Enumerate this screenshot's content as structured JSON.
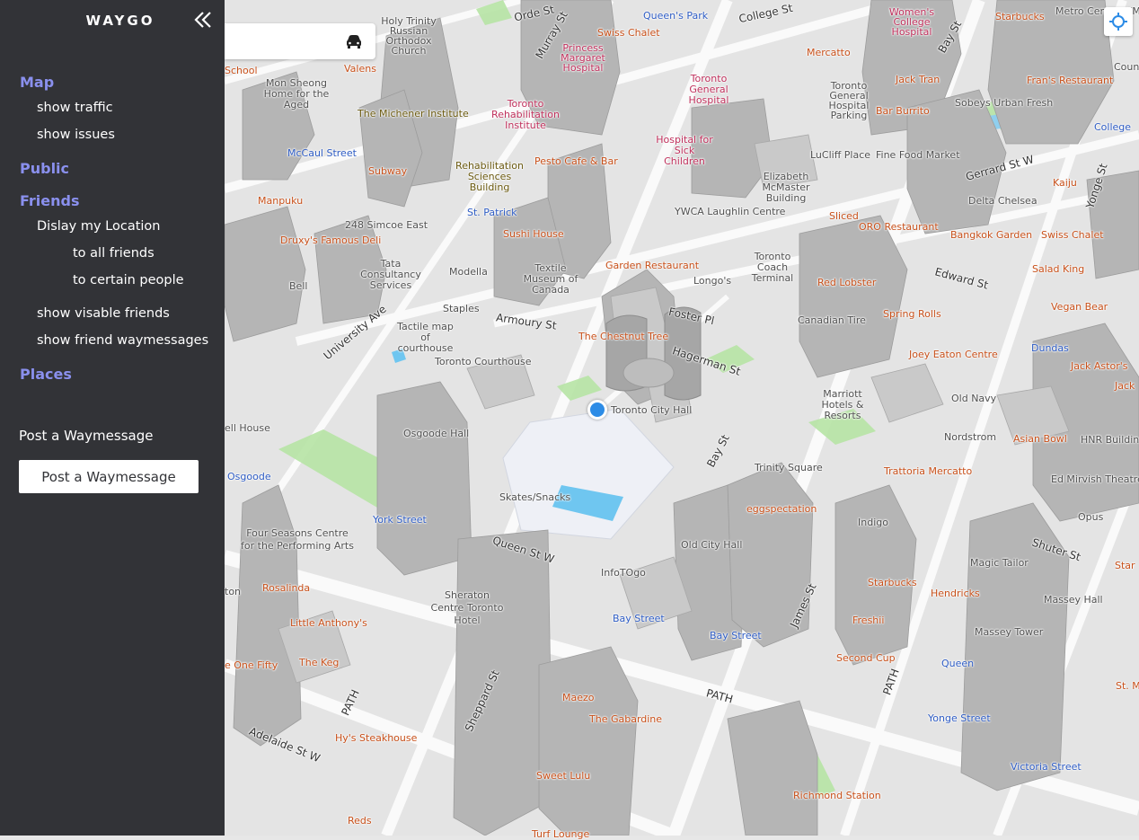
{
  "sidebar": {
    "brand": "WAYGO",
    "collapse_icon": "chevron-double-left-icon",
    "sections": {
      "map": {
        "label": "Map",
        "items": [
          "show traffic",
          "show issues"
        ]
      },
      "public": {
        "label": "Public"
      },
      "friends": {
        "label": "Friends",
        "display_location": "Dislay my Location",
        "to_all": "to all friends",
        "to_certain": "to certain people",
        "visible_friends": "show visable friends",
        "waymessages": "show friend waymessages"
      },
      "places": {
        "label": "Places"
      }
    },
    "post_label": "Post a Waymessage",
    "post_button": "Post a Waymessage",
    "colors": {
      "background": "#323337",
      "accent": "#8a90ee"
    }
  },
  "map": {
    "search_icon": "car-icon",
    "locate_icon": "crosshair-icon",
    "streets": [
      "Orde St",
      "College St",
      "Murray St",
      "Gerrard St W",
      "Bay St",
      "Yonge St",
      "University Ave",
      "Armoury St",
      "Foster Pl",
      "Hagerman St",
      "Edward St",
      "Queen St W",
      "Bay St",
      "James St",
      "Shuter St",
      "Sheppard St",
      "Adelaide St W",
      "PATH",
      "PATH",
      "PATH"
    ],
    "labels": {
      "holy_trinity": "Holy Trinity Russian Orthodox Church",
      "queens_park": "Queen's Park",
      "womens_college": "Women's College Hospital",
      "starbucks_top": "Starbucks",
      "metro_central": "Metro Central YMCA",
      "swiss_chalet_top": "Swiss Chalet",
      "princess_margaret": "Princess Margaret Hospital",
      "mercatto": "Mercatto",
      "valens": "Valens",
      "school": "School",
      "mon_sheong": "Mon Sheong Home for the Aged",
      "michener": "The Michener Institute",
      "toronto_rehab": "Toronto Rehabilitation Institute",
      "toronto_general": "Toronto General Hospital",
      "tgh_parking": "Toronto General Hospital Parking",
      "jack_tran": "Jack Tran",
      "bar_burrito": "Bar Burrito",
      "sobeys": "Sobeys Urban Fresh",
      "frans": "Fran's Restaurant",
      "county": "County",
      "college": "College",
      "mccaul": "McCaul Street",
      "subway": "Subway",
      "rehab_sciences": "Rehabilitation Sciences Building",
      "pesto": "Pesto Cafe & Bar",
      "sick_kids": "Hospital for Sick Children",
      "luclif": "LuCliff Place",
      "fine_food": "Fine Food Market",
      "kaiju": "Kaiju",
      "manpuku": "Manpuku",
      "simcoe": "248 Simcoe East",
      "st_patrick": "St. Patrick",
      "mcmaster": "Elizabeth McMaster Building",
      "delta": "Delta Chelsea",
      "ywca": "YWCA Laughlin Centre",
      "sliced": "Sliced",
      "oro": "ORO Restaurant",
      "bangkok": "Bangkok Garden",
      "swiss_chalet": "Swiss Chalet",
      "druxys": "Druxy's Famous Deli",
      "sushi_house": "Sushi House",
      "tata": "Tata Consultancy Services",
      "modella": "Modella",
      "textile": "Textile Museum of Canada",
      "garden_rest": "Garden Restaurant",
      "coach": "Toronto Coach Terminal",
      "salad_king": "Salad King",
      "bell": "Bell",
      "longos": "Longo's",
      "red_lobster": "Red Lobster",
      "vegan_bear": "Vegan Bear",
      "staples": "Staples",
      "spring_rolls": "Spring Rolls",
      "canadian_tire": "Canadian Tire",
      "tactile": "Tactile map of courthouse",
      "dundas": "Dundas",
      "chestnut": "The Chestnut Tree",
      "joey": "Joey Eaton Centre",
      "jack_astors": "Jack Astor's",
      "courthouse": "Toronto Courthouse",
      "jack": "Jack",
      "marriott": "Marriott Hotels & Resorts",
      "old_navy": "Old Navy",
      "city_hall": "Toronto City Hall",
      "bell_house": "ell House",
      "osgoode_hall": "Osgoode Hall",
      "nordstrom": "Nordstrom",
      "asian_bowl": "Asian Bowl",
      "hnr": "HNR Building",
      "osgoode": "Osgoode",
      "trinity": "Trinity Square",
      "trattoria": "Trattoria Mercatto",
      "mirvish": "Ed Mirvish Theatre",
      "skates": "Skates/Snacks",
      "eggspectation": "eggspectation",
      "york": "York Street",
      "indigo": "Indigo",
      "opus": "Opus",
      "four_seasons": "Four Seasons Centre for the Performing Arts",
      "old_city_hall": "Old City Hall",
      "magic_tailor": "Magic Tailor",
      "star": "Star",
      "infotogo": "InfoTOgo",
      "rosalinda": "Rosalinda",
      "ton": "ton",
      "starbucks": "Starbucks",
      "hendricks": "Hendricks",
      "massey": "Massey Hall",
      "sheraton": "Sheraton Centre Toronto Hotel",
      "bay_station": "Bay Street",
      "freshii": "Freshii",
      "little_anthonys": "Little Anthony's",
      "bay_street_left": "Bay Street",
      "massey_tower": "Massey Tower",
      "one_fifty": "e One Fifty",
      "the_keg": "The Keg",
      "second_cup": "Second Cup",
      "queen": "Queen",
      "st_m": "St. M",
      "maezo": "Maezo",
      "gabardine": "The Gabardine",
      "yonge_station": "Yonge Street",
      "hys": "Hy's Steakhouse",
      "victoria": "Victoria Street",
      "sweet_lulu": "Sweet Lulu",
      "richmond": "Richmond Station",
      "reds": "Reds",
      "turf": "Turf Lounge"
    }
  }
}
